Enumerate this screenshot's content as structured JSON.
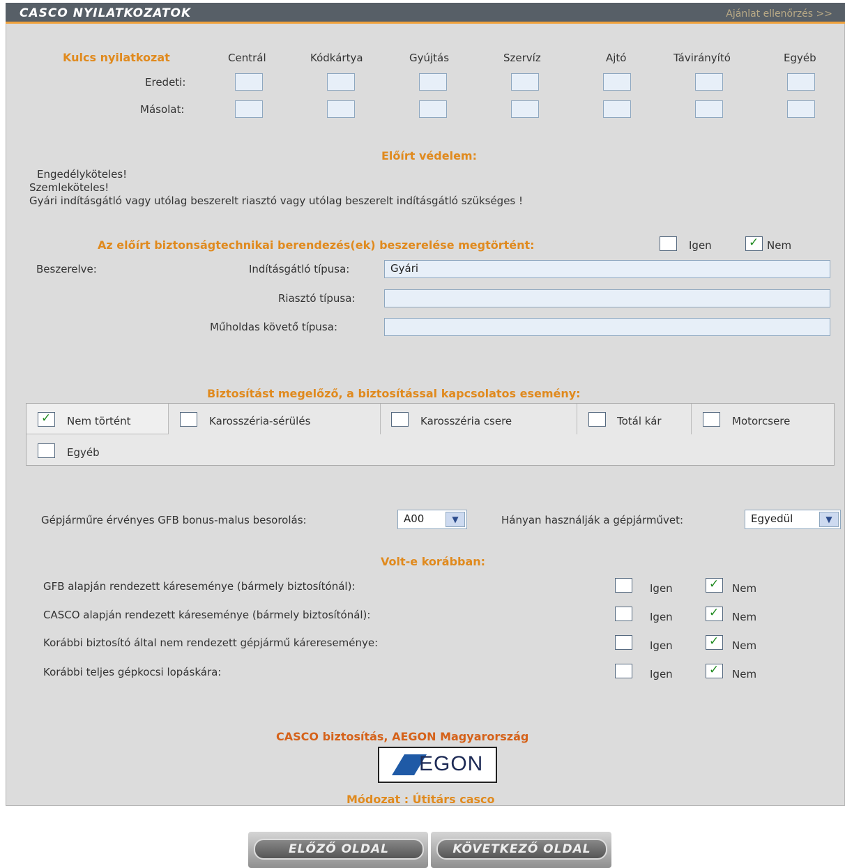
{
  "header": {
    "title": "CASCO NYILATKOZATOK",
    "check_link": "Ajánlat ellenőrzés >>"
  },
  "key": {
    "title": "Kulcs nyilatkozat",
    "columns": [
      "Centrál",
      "Kódkártya",
      "Gyújtás",
      "Szervíz",
      "Ajtó",
      "Távirányító",
      "Egyéb"
    ],
    "row_original": "Eredeti:",
    "row_copy": "Másolat:"
  },
  "protection": {
    "title": "Előírt védelem:",
    "lines": [
      "Engedélyköteles!",
      "Szemleköteles!",
      "Gyári indításgátló vagy utólag beszerelt riasztó vagy utólag beszerelt indításgátló szükséges !"
    ]
  },
  "install": {
    "question": "Az előírt biztonságtechnikai berendezés(ek) beszerelése megtörtént:",
    "yes": "Igen",
    "no": "Nem",
    "installed_label": "Beszerelve:",
    "immobilizer_label": "Indításgátló típusa:",
    "immobilizer_value": "Gyári",
    "alarm_label": "Riasztó típusa:",
    "alarm_value": "",
    "satellite_label": "Műholdas követő típusa:",
    "satellite_value": ""
  },
  "events": {
    "title": "Biztosítást megelőző, a biztosítással kapcsolatos esemény:",
    "items": [
      "Nem történt",
      "Karosszéria-sérülés",
      "Karosszéria csere",
      "Totál kár",
      "Motorcsere",
      "Egyéb"
    ]
  },
  "bonus": {
    "label": "Gépjárműre érvényes GFB bonus-malus besorolás:",
    "value": "A00"
  },
  "users": {
    "label": "Hányan használják a gépjárművet:",
    "value": "Egyedül"
  },
  "history": {
    "title": "Volt-e korábban:",
    "yes": "Igen",
    "no": "Nem",
    "questions": [
      "GFB alapján rendezett káreseménye (bármely biztosítónál):",
      "CASCO alapján rendezett káreseménye (bármely biztosítónál):",
      "Korábbi biztosító által nem rendezett gépjármű kárereseménye:",
      "Korábbi teljes gépkocsi lopáskára:"
    ]
  },
  "footer": {
    "insurer": "CASCO biztosítás, AEGON Magyarország",
    "logo_text": "EGON",
    "plan": "Módozat : Útitárs casco"
  },
  "nav": {
    "prev": "ELŐZŐ OLDAL",
    "next": "KÖVETKEZŐ OLDAL"
  },
  "colors": {
    "header": "#575f67",
    "accent": "#e08a1e",
    "panel": "#dcdcdc"
  }
}
